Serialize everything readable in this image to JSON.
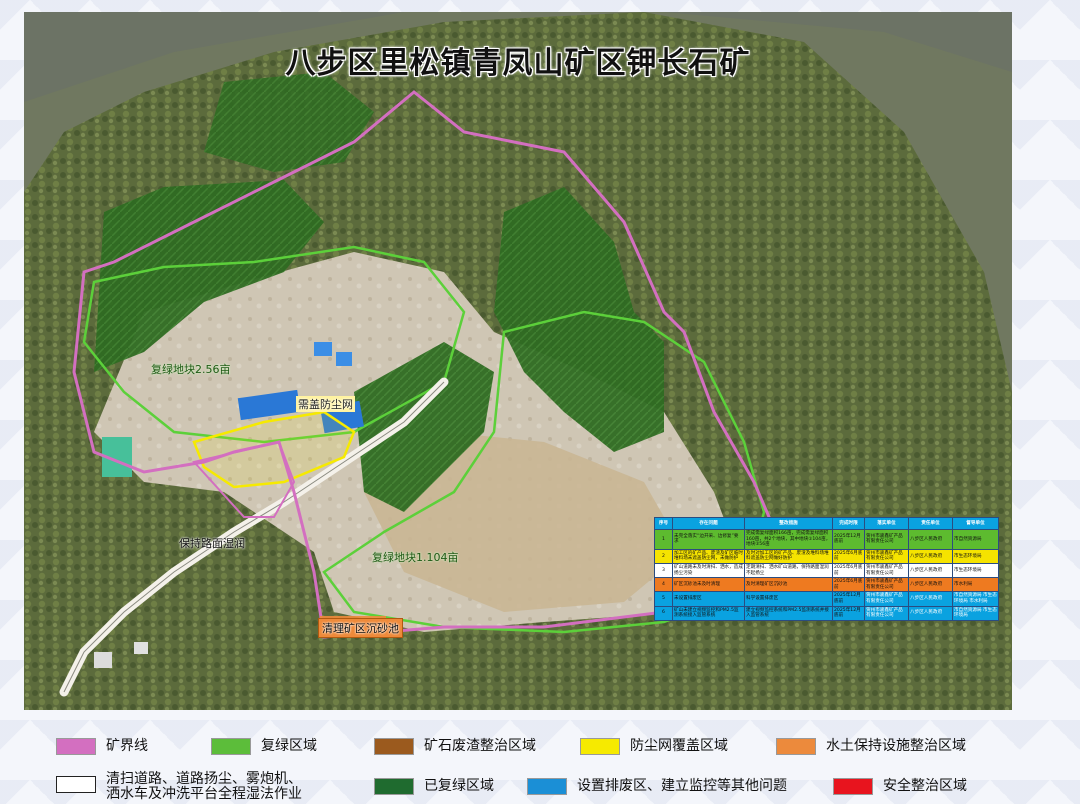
{
  "map": {
    "title": "八步区里松镇青凤山矿区钾长石矿",
    "labels": {
      "restored_area_left": "复绿地块2.56亩",
      "restored_area_right": "复绿地块1.104亩",
      "dust_net": "需盖防尘网",
      "road_wet": "保持路面湿润",
      "clean_sediment": "清理矿区沉砂池"
    }
  },
  "table": {
    "headers": [
      "序号",
      "存在问题",
      "整改措施",
      "完成时限",
      "落实单位",
      "责任单位",
      "督导单位"
    ],
    "rows": [
      {
        "color": "#5dbb2f",
        "no": "1",
        "problem": "未完全落实“边开采、边修复”要求",
        "measure": "完成需复绿面积166亩，完成需复绿面积160亩，共2个地块，其中地块①104亩，地块②56亩",
        "deadline": "2025年12月底前",
        "implementer": "贺州市骏鑫矿产品有限责任公司",
        "responsible": "八步区人民政府",
        "supervisor": "市自然资源局"
      },
      {
        "color": "#f5e300",
        "no": "2",
        "problem": "加工区的矿产品、废渣及矿区临时堆料场未遮盖防尘网，未做防护",
        "measure": "及时对加工区的矿产品、废渣及堆料场堆料遮盖防尘网做好防护",
        "deadline": "2025年6月底前",
        "implementer": "贺州市骏鑫矿产品有限责任公司",
        "responsible": "八步区人民政府",
        "supervisor": "市生态环境局"
      },
      {
        "color": "#ffffff",
        "no": "3",
        "problem": "矿山道路未及时清扫、洒水，造成扬尘污染",
        "measure": "定期清扫、洒水矿山道路，保持路面湿润不起扬尘",
        "deadline": "2025年6月底前",
        "implementer": "贺州市骏鑫矿产品有限责任公司",
        "responsible": "八步区人民政府",
        "supervisor": "市生态环境局"
      },
      {
        "color": "#ee7a20",
        "no": "4",
        "problem": "矿区沉砂池未及时清理",
        "measure": "及时清理矿区沉砂池",
        "deadline": "2025年6月底前",
        "implementer": "贺州市骏鑫矿产品有限责任公司",
        "responsible": "八步区人民政府",
        "supervisor": "市水利局"
      },
      {
        "color": "#0aa2e0",
        "no": "5",
        "problem": "未设置排废区",
        "measure": "科学设置排废区",
        "deadline": "2025年12月底前",
        "implementer": "贺州市骏鑫矿产品有限责任公司",
        "responsible": "八步区人民政府",
        "supervisor": "市自然资源局 市生态环境局 市水利局"
      },
      {
        "color": "#0aa2e0",
        "no": "6",
        "problem": "矿山未建立视频监控和PM2.5监测系统接入监管系统",
        "measure": "建立视频监控系统和PM2.5监测系统并接入监管系统",
        "deadline": "2025年12月底前",
        "implementer": "贺州市骏鑫矿产品有限责任公司",
        "responsible": "八步区人民政府",
        "supervisor": "市自然资源局 市生态环境局"
      }
    ]
  },
  "legend": [
    {
      "key": "boundary",
      "label": "矿界线",
      "color": "#d36fc0"
    },
    {
      "key": "restore",
      "label": "复绿区域",
      "color": "#5cbd3a"
    },
    {
      "key": "waste",
      "label": "矿石废渣整治区域",
      "color": "#9b5a1e"
    },
    {
      "key": "dust",
      "label": "防尘网覆盖区域",
      "color": "#f6ea00"
    },
    {
      "key": "soil",
      "label": "水土保持设施整治区域",
      "color": "#ec8a3c"
    },
    {
      "key": "road_line1",
      "label": "清扫道路、道路扬尘、雾炮机、",
      "color": "#ffffff"
    },
    {
      "key": "road_line2",
      "label": "洒水车及冲洗平台全程湿法作业",
      "color": "#ffffff"
    },
    {
      "key": "restored",
      "label": "已复绿区域",
      "color": "#1f6b2f"
    },
    {
      "key": "other",
      "label": "设置排废区、建立监控等其他问题",
      "color": "#1b8fd6"
    },
    {
      "key": "safety",
      "label": "安全整治区域",
      "color": "#e8141e"
    }
  ]
}
